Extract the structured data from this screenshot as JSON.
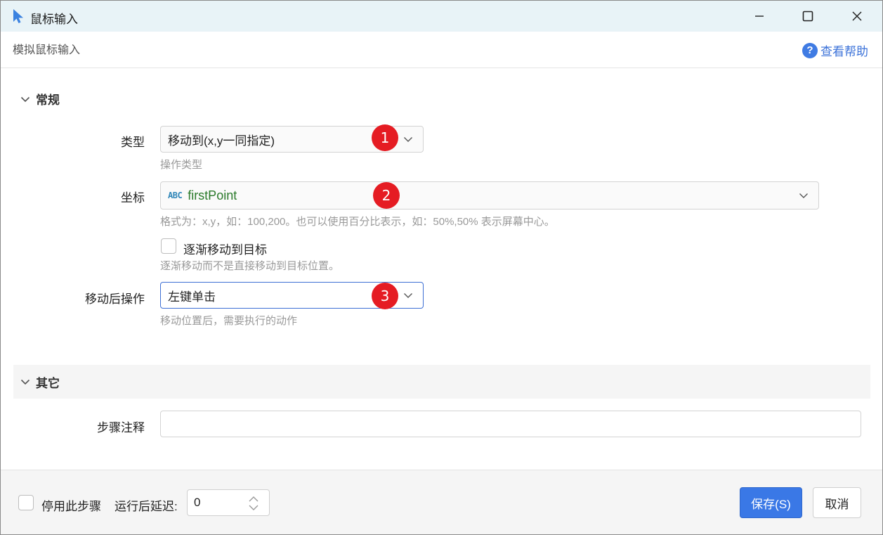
{
  "window": {
    "title": "鼠标输入",
    "subtitle": "模拟鼠标输入",
    "help_label": "查看帮助"
  },
  "general": {
    "section_title": "常规",
    "type": {
      "label": "类型",
      "value": "移动到(x,y一同指定)",
      "hint": "操作类型",
      "badge": "1"
    },
    "coords": {
      "label": "坐标",
      "type_tag": "ABC",
      "value": "firstPoint",
      "hint": "格式为：x,y，如：100,200。也可以使用百分比表示，如：50%,50% 表示屏幕中心。",
      "badge": "2"
    },
    "gradual": {
      "label": "逐渐移动到目标",
      "hint": "逐渐移动而不是直接移动到目标位置。",
      "checked": false
    },
    "after_move": {
      "label": "移动后操作",
      "value": "左键单击",
      "hint": "移动位置后，需要执行的动作",
      "badge": "3"
    }
  },
  "other": {
    "section_title": "其它",
    "note_label": "步骤注释",
    "note_value": ""
  },
  "footer": {
    "disable_label": "停用此步骤",
    "disable_checked": false,
    "delay_label": "运行后延迟:",
    "delay_value": "0",
    "save_label": "保存(S)",
    "cancel_label": "取消"
  },
  "colors": {
    "accent": "#3a78e6",
    "badge": "#e51c23",
    "titlebar": "#e8f3f7"
  }
}
